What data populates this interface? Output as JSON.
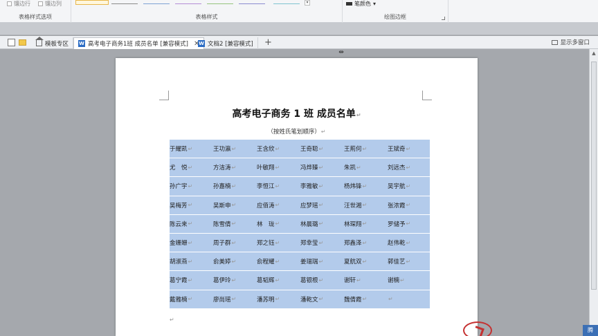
{
  "ribbon": {
    "groups": [
      {
        "label": "表格样式选项",
        "options": [
          "镶边行",
          "镶边列"
        ]
      },
      {
        "label": "表格样式"
      },
      {
        "label": "绘图边框",
        "pen_color_label": "笔颜色"
      }
    ]
  },
  "tabs": [
    {
      "label": "模板专区",
      "icon": "home-icon"
    },
    {
      "label": "高考电子商务1班 成员名单 [兼容模式]",
      "icon": "word-doc-icon",
      "active": true
    },
    {
      "label": "文档2 [兼容模式]",
      "icon": "word-doc-icon"
    }
  ],
  "multi_window_label": "显示多窗口",
  "document": {
    "title": "高考电子商务 1 班  成员名单",
    "subtitle": "（按姓氏笔划顺序）",
    "table_color": "#b3cbeb",
    "rows": [
      [
        "于耀凯",
        "王功瀛",
        "王含欣",
        "王奇聪",
        "王荊何",
        "王斌奇"
      ],
      [
        "尤　悦",
        "方洁涛",
        "叶敏翔",
        "冯烨臻",
        "朱凯",
        "刘远杰"
      ],
      [
        "孙广宇",
        "孙嘉楠",
        "李恒江",
        "李雅敏",
        "杨炜锋",
        "吴宇航"
      ],
      [
        "吴梅芳",
        "吴斯申",
        "应佰涛",
        "应梦瑶",
        "汪世湘",
        "张浓霞"
      ],
      [
        "陈云来",
        "陈雪倩",
        "林　珑",
        "林晨璐",
        "林琛翔",
        "罗储予"
      ],
      [
        "金姗姗",
        "周子群",
        "郑之钰",
        "郑幸莹",
        "郑鑫泽",
        "赵伟乾"
      ],
      [
        "胡淑燕",
        "俞美婷",
        "俞程耀",
        "姜瑞瑞",
        "夏航双",
        "郭佳艺"
      ],
      [
        "葛宁霞",
        "葛伊玲",
        "葛韬辉",
        "葛银根",
        "谢轩",
        "谢楠"
      ],
      [
        "戴雅楠",
        "廖尚瑶",
        "潘苏明",
        "潘乾文",
        "魏倩霞",
        ""
      ]
    ]
  },
  "corner_button_label": "腾"
}
